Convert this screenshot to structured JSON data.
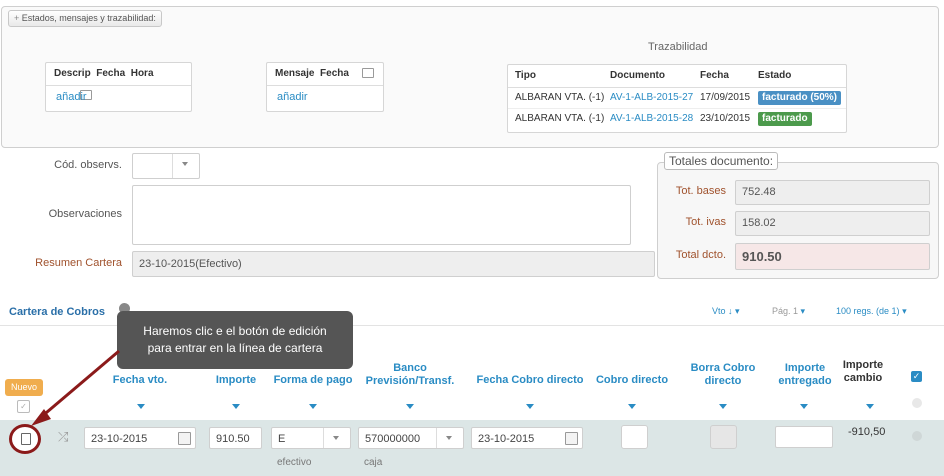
{
  "section_tab": "Estados, mensajes y trazabilidad:",
  "states_table": {
    "headers": [
      "Descrip",
      "Fecha",
      "Hora"
    ],
    "add_link": "añadir"
  },
  "messages_table": {
    "headers": [
      "Mensaje",
      "Fecha"
    ],
    "add_link": "añadir"
  },
  "traceability": {
    "title": "Trazabilidad",
    "headers": [
      "Tipo",
      "Documento",
      "Fecha",
      "Estado"
    ],
    "rows": [
      {
        "tipo": "ALBARAN VTA. (-1)",
        "documento": "AV-1-ALB-2015-27",
        "fecha": "17/09/2015",
        "estado": "facturado (50%)",
        "estado_color": "#4a90c4"
      },
      {
        "tipo": "ALBARAN VTA. (-1)",
        "documento": "AV-1-ALB-2015-28",
        "fecha": "23/10/2015",
        "estado": "facturado",
        "estado_color": "#4c9a4c"
      }
    ]
  },
  "form": {
    "cod_observ_label": "Cód. observs.",
    "observaciones_label": "Observaciones",
    "resumen_label": "Resumen Cartera",
    "resumen_value": "23-10-2015(Efectivo)"
  },
  "totals": {
    "title": "Totales documento:",
    "bases_label": "Tot. bases",
    "bases_value": "752.48",
    "ivas_label": "Tot. ivas",
    "ivas_value": "158.02",
    "total_label": "Total dcto.",
    "total_value": "910.50"
  },
  "cartera": {
    "title": "Cartera de Cobros",
    "vto_label": "Vto ↓",
    "page_label": "Pág. 1",
    "regs_label": "100 regs. (de 1)",
    "nuevo_button": "Nuevo",
    "columns": {
      "fecha_vto": "Fecha vto.",
      "importe": "Importe",
      "forma_pago": "Forma de pago",
      "banco": "Banco\nPrevisión/Transf.",
      "fecha_cobro": "Fecha Cobro directo",
      "cobro_directo": "Cobro directo",
      "borra_cobro": "Borra Cobro\ndirecto",
      "importe_entregado": "Importe\nentregado",
      "importe_cambio": "Importe\ncambio"
    },
    "row": {
      "fecha_vto": "23-10-2015",
      "importe": "910.50",
      "forma_pago": "E",
      "forma_pago_desc": "efectivo",
      "banco": "570000000",
      "banco_desc": "caja",
      "fecha_cobro": "23-10-2015",
      "importe_cambio": "-910,50"
    }
  },
  "tooltip": "Haremos clic e el botón de edición para entrar en la línea de cartera",
  "colors": {
    "accent": "#2a8cc4",
    "nuevo": "#f0ad4e",
    "row_bg": "#dce6e6",
    "highlight": "#8b1a1a"
  }
}
